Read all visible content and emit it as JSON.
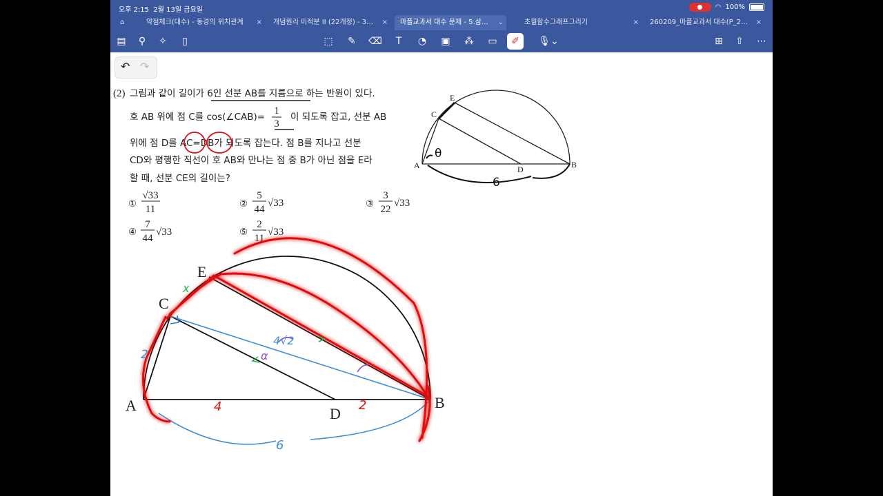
{
  "status": {
    "time": "오후 2:15",
    "date": "2월 13일 금요일",
    "battery": "100%"
  },
  "tabs": [
    {
      "label": "약점체크(대수) - 동경의 위치관계",
      "active": false
    },
    {
      "label": "개념원리 미적분 II (22개정) - 3…",
      "active": false
    },
    {
      "label": "마플교과서 대수 문제 - 5.삼…",
      "active": true
    },
    {
      "label": "초월함수그래프그리기",
      "active": false
    },
    {
      "label": "260209_마플교과서 대수(P_2…",
      "active": false
    }
  ],
  "problem": {
    "number": "(2)",
    "line1a": "그림과 같이 길이가 ",
    "line1b": "6인 선분 AB를 지름",
    "line1c": "으로 하는 반원이 있다.",
    "line2a": "호 AB 위에 점 C를 cos(∠CAB)=",
    "frac_num": "1",
    "frac_den": "3",
    "line2b": "이 되도록 잡고, 선분 AB",
    "line3a": "위에 점 D를 ",
    "ac": "AC",
    "eq": "=",
    "db": "DB",
    "line3b": "가 되도록 잡는다. 점 B를 지나고 선분",
    "line4": "CD와 평행한 직선이 호 AB와 만나는 점 중 B가 아닌 점을 E라",
    "line5": "할 때, 선분 CE의 길이는?"
  },
  "choices": [
    {
      "num": "①",
      "numer": "√33",
      "denom": "11",
      "tail": ""
    },
    {
      "num": "②",
      "numer": "5",
      "denom": "44",
      "tail": "√33"
    },
    {
      "num": "③",
      "numer": "3",
      "denom": "22",
      "tail": "√33"
    },
    {
      "num": "④",
      "numer": "7",
      "denom": "44",
      "tail": "√33"
    },
    {
      "num": "⑤",
      "numer": "2",
      "denom": "11",
      "tail": "√33"
    }
  ],
  "small_figure": {
    "points": [
      "E",
      "C",
      "A",
      "D",
      "B"
    ],
    "angle": "θ",
    "length": "6"
  },
  "big_figure": {
    "points": [
      "E",
      "C",
      "A",
      "D",
      "B"
    ],
    "notes": {
      "ad": "4",
      "db": "2",
      "ab": "6",
      "ac": "2",
      "cb": "4√2",
      "ce": "x",
      "alpha": "α"
    }
  },
  "colors": {
    "chrome": "#3b579d",
    "ink_red": "#e01010",
    "ink_blue": "#3a8fd8",
    "ink_green": "#2bb44a",
    "ink_purple": "#8a4fd8"
  }
}
